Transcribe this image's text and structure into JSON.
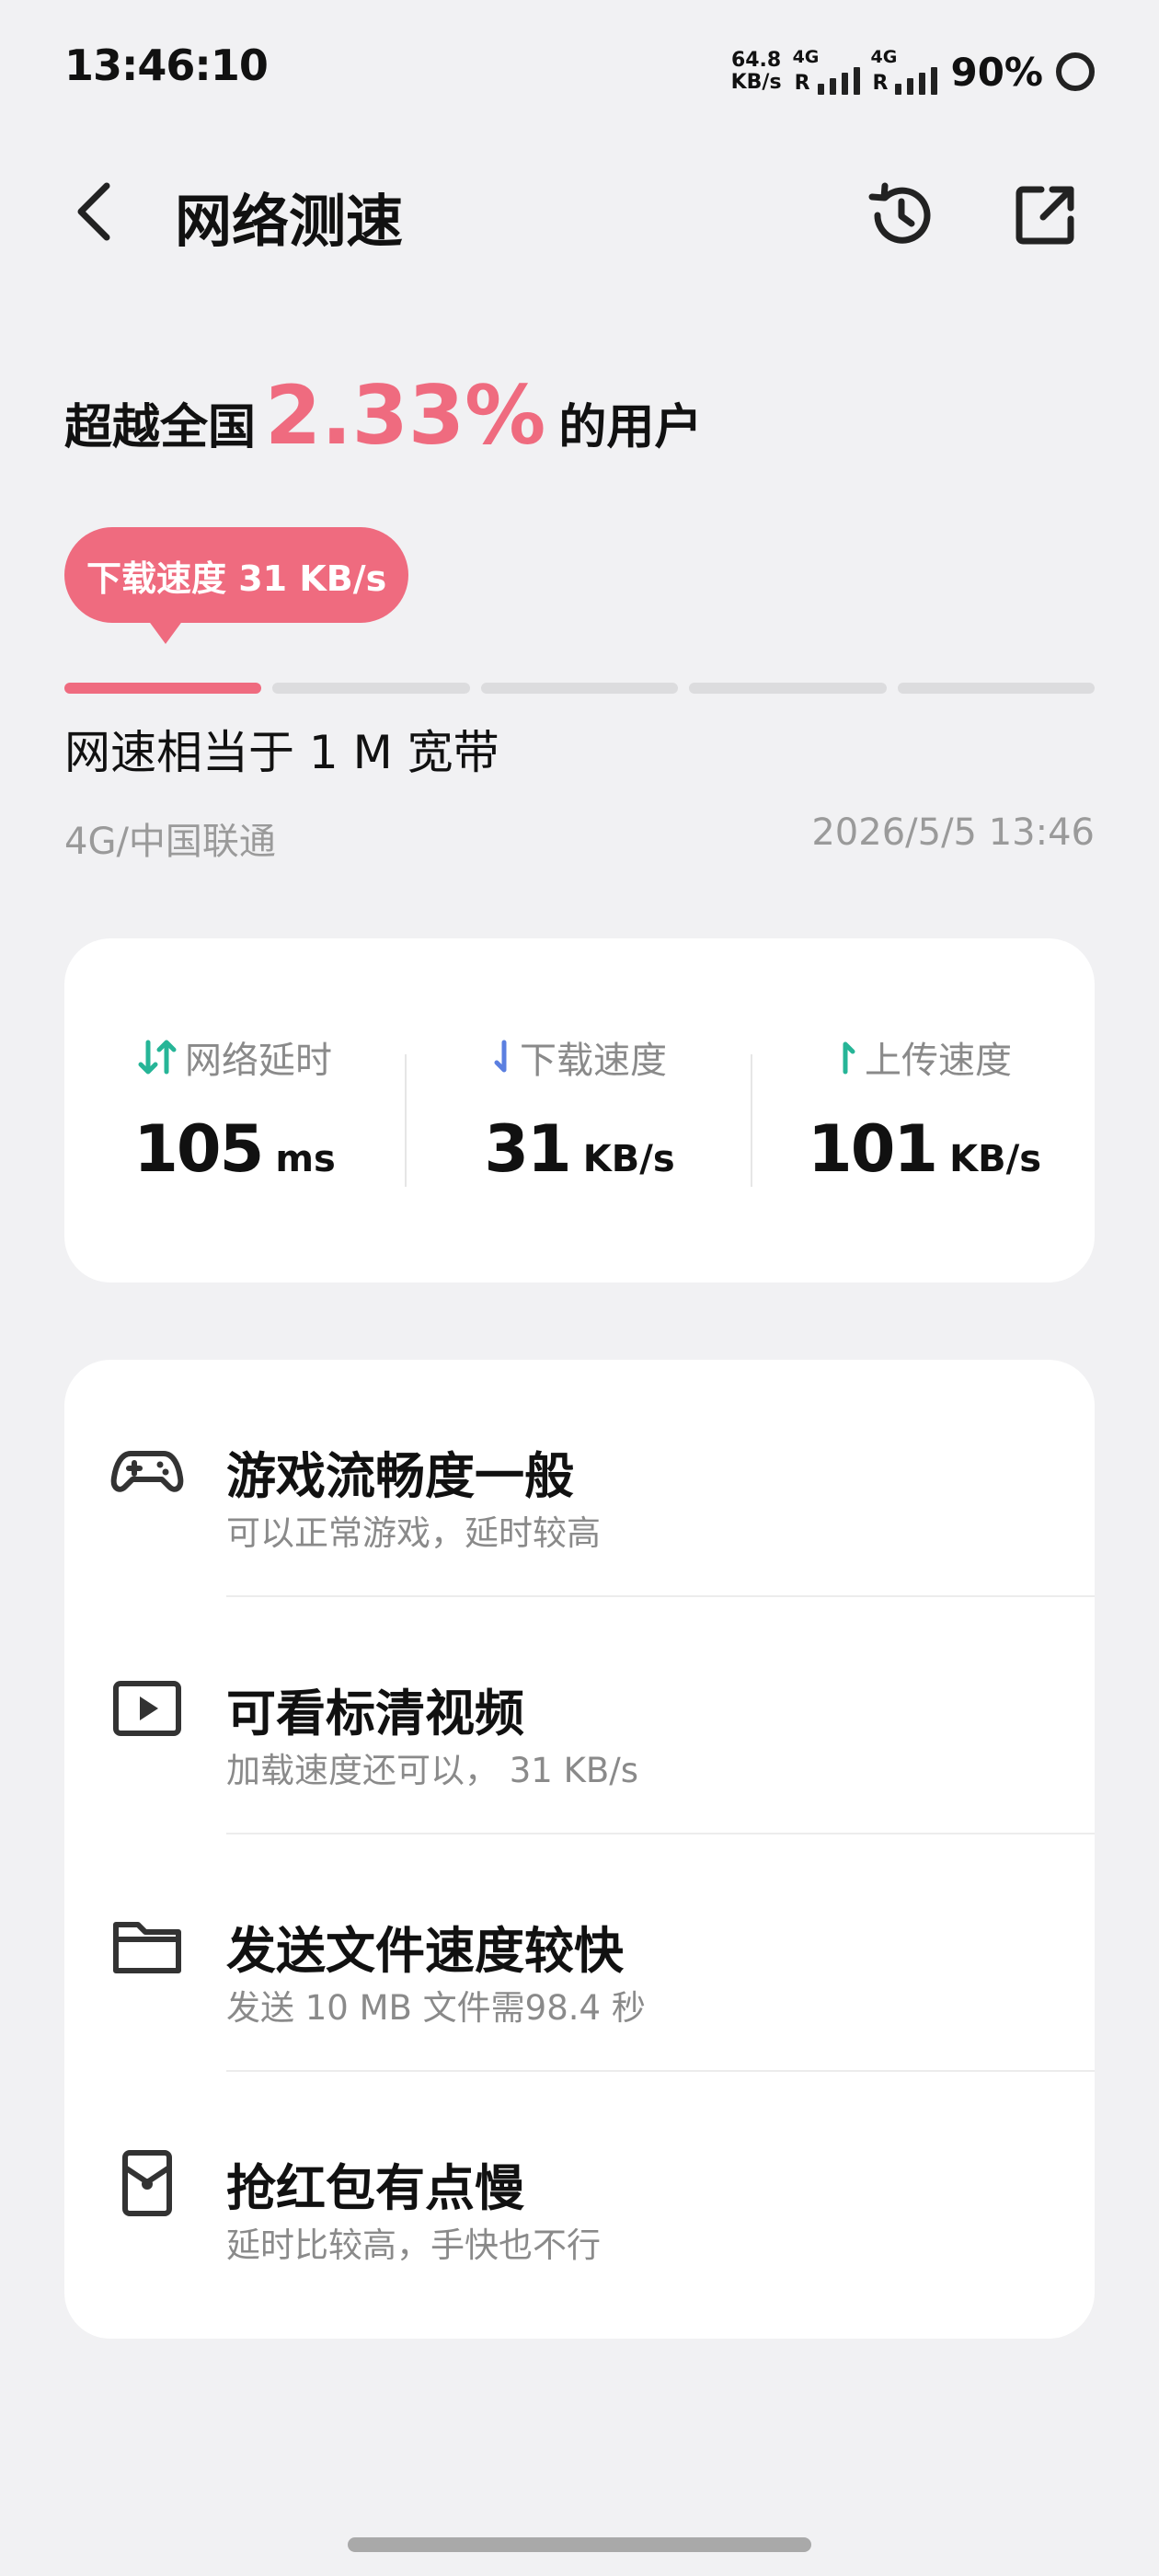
{
  "status_bar": {
    "time": "13:46:10",
    "net_speed_value": "64.8",
    "net_speed_unit": "KB/s",
    "sim1_tag": "4G",
    "sim1_roaming": "R",
    "sim2_tag": "4G",
    "sim2_roaming": "R",
    "battery": "90%"
  },
  "header": {
    "title": "网络测速",
    "back_icon": "chevron-left-icon",
    "history_icon": "history-icon",
    "share_icon": "share-icon"
  },
  "result": {
    "rank_prefix": "超越全国",
    "rank_percent": "2.33%",
    "rank_suffix": "的用户",
    "speed_bubble": "下载速度 31 KB/s",
    "level_segments": 5,
    "level_active": 1,
    "equivalent": "网速相当于 1 M 宽带",
    "carrier": "4G/中国联通",
    "time": "2026/5/5 13:46",
    "accent_color": "#ef6b7f"
  },
  "metrics": [
    {
      "label": "网络延时",
      "value": "105",
      "unit": "ms",
      "icon": "latency-icon"
    },
    {
      "label": "下载速度",
      "value": "31",
      "unit": "KB/s",
      "icon": "download-arrow-icon"
    },
    {
      "label": "上传速度",
      "value": "101",
      "unit": "KB/s",
      "icon": "upload-arrow-icon"
    }
  ],
  "features": [
    {
      "title": "游戏流畅度一般",
      "desc": "可以正常游戏，延时较高",
      "icon": "gamepad-icon"
    },
    {
      "title": "可看标清视频",
      "desc": "加载速度还可以， 31 KB/s",
      "icon": "video-play-icon"
    },
    {
      "title": "发送文件速度较快",
      "desc": "发送 10 MB 文件需98.4 秒",
      "icon": "folder-icon"
    },
    {
      "title": "抢红包有点慢",
      "desc": "延时比较高，手快也不行",
      "icon": "red-packet-icon"
    }
  ]
}
